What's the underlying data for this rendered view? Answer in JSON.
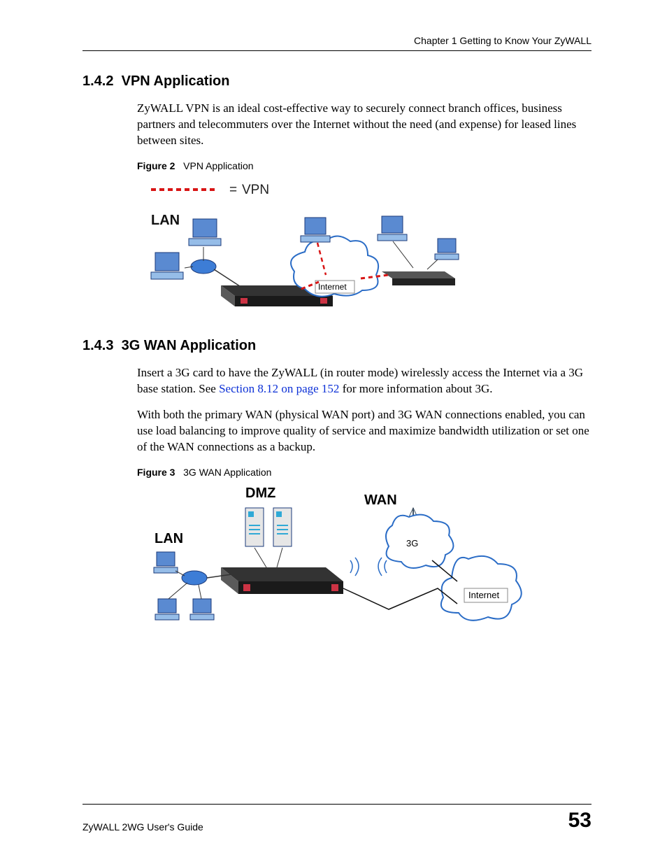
{
  "header": {
    "chapter": "Chapter 1 Getting to Know Your ZyWALL"
  },
  "sections": {
    "s142": {
      "number": "1.4.2",
      "title": "VPN Application",
      "para": "ZyWALL VPN is an ideal cost-effective way to securely connect branch offices, business partners and telecommuters over the Internet without the need (and expense) for leased lines between sites.",
      "figLabel": "Figure 2",
      "figTitle": "VPN Application",
      "diagram": {
        "legend_eq": "=",
        "legend_vpn": "VPN",
        "lan": "LAN",
        "internet": "Internet"
      }
    },
    "s143": {
      "number": "1.4.3",
      "title": "3G WAN Application",
      "para1a": "Insert a 3G card to have the ZyWALL (in router mode) wirelessly access the Internet via a 3G base station. See ",
      "para1link": "Section 8.12 on page 152",
      "para1b": " for more information about 3G.",
      "para2": "With both the primary WAN (physical WAN port) and 3G WAN connections enabled, you can use load balancing to improve quality of service and maximize bandwidth utilization or set one of the WAN connections as a backup.",
      "figLabel": "Figure 3",
      "figTitle": "3G WAN Application",
      "diagram": {
        "dmz": "DMZ",
        "wan": "WAN",
        "lan": "LAN",
        "threeg": "3G",
        "internet": "Internet"
      }
    }
  },
  "footer": {
    "guide": "ZyWALL 2WG User's Guide",
    "page": "53"
  }
}
